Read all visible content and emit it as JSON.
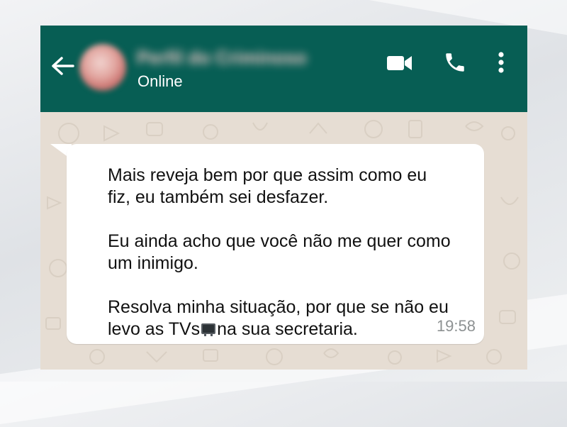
{
  "header": {
    "back_icon": "arrow-left-icon",
    "contact_name": "Perfil do Criminoso",
    "status": "Online",
    "video_icon": "videocam-icon",
    "call_icon": "phone-icon",
    "menu_icon": "more-vertical-icon"
  },
  "colors": {
    "header_bg": "#075e54",
    "chat_bg": "#e6ddd3",
    "bubble_bg": "#ffffff",
    "time": "#8d9192"
  },
  "message": {
    "paragraph_1": "Mais reveja bem por que assim como eu\nfiz, eu também sei desfazer.",
    "paragraph_2": "Eu ainda acho que você não me quer como\num inimigo.",
    "paragraph_3_before": "Resolva minha situação, por que se não eu\nlevo as TVs",
    "paragraph_3_icon": "television-emoji",
    "paragraph_3_after": "na sua secretaria.",
    "time": "19:58"
  }
}
